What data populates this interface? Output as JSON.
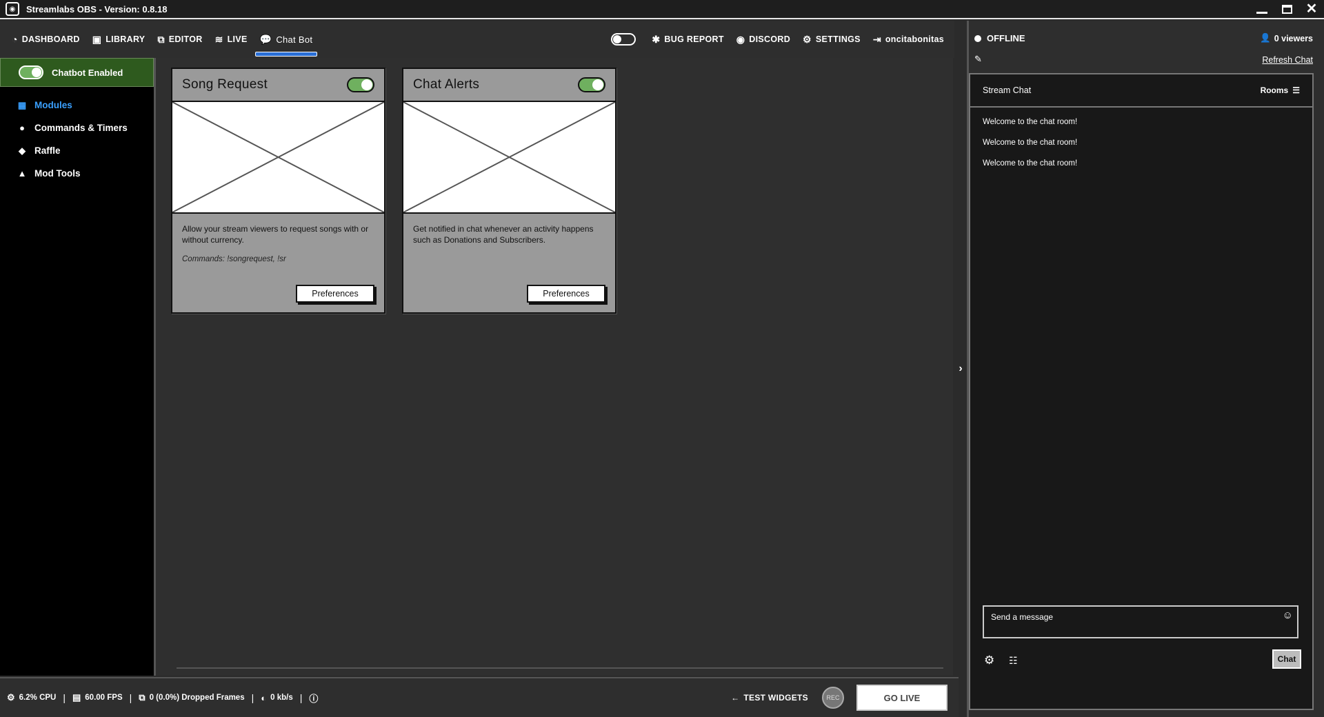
{
  "window": {
    "title": "Streamlabs OBS - Version: 0.8.18",
    "close_glyph": "✕"
  },
  "topnav": {
    "left": [
      {
        "label": "DASHBOARD",
        "icon": "dashboard-icon",
        "glyph": "◔"
      },
      {
        "label": "LIBRARY",
        "icon": "image-icon",
        "glyph": "▣"
      },
      {
        "label": "EDITOR",
        "icon": "editor-icon",
        "glyph": "⧉"
      },
      {
        "label": "LIVE",
        "icon": "rss-icon",
        "glyph": "≋"
      },
      {
        "label": "Chat Bot",
        "icon": "chat-bubble-icon",
        "glyph": "💬",
        "active": true
      }
    ],
    "right": [
      {
        "label": "BUG REPORT",
        "icon": "bug-icon",
        "glyph": "✱"
      },
      {
        "label": "DISCORD",
        "icon": "discord-icon",
        "glyph": "◉"
      },
      {
        "label": "SETTINGS",
        "icon": "gear-icon",
        "glyph": "⚙"
      },
      {
        "label": "oncitabonitas",
        "icon": "logout-icon",
        "glyph": "⇥"
      }
    ]
  },
  "sidebar": {
    "chatbot_enabled_label": "Chatbot Enabled",
    "chatbot_enabled": true,
    "items": [
      {
        "label": "Modules",
        "icon": "grid-icon",
        "glyph": "▦",
        "active": true
      },
      {
        "label": "Commands & Timers",
        "icon": "comment-icon",
        "glyph": "●"
      },
      {
        "label": "Raffle",
        "icon": "ticket-icon",
        "glyph": "◆"
      },
      {
        "label": "Mod Tools",
        "icon": "lock-icon",
        "glyph": "▲"
      }
    ]
  },
  "modules": [
    {
      "title": "Song Request",
      "enabled": true,
      "description": "Allow your stream viewers to request songs with or without currency.",
      "commands": "Commands: !songrequest, !sr",
      "button": "Preferences"
    },
    {
      "title": "Chat Alerts",
      "enabled": true,
      "description": "Get notified in chat whenever an activity happens such as Donations and Subscribers.",
      "commands": "",
      "button": "Preferences"
    }
  ],
  "chat_panel": {
    "status": "OFFLINE",
    "viewers": "0 viewers",
    "refresh_label": "Refresh Chat",
    "header": "Stream Chat",
    "rooms_label": "Rooms",
    "messages": [
      "Welcome to the chat room!",
      "Welcome to the chat room!",
      "Welcome to the chat room!"
    ],
    "input_placeholder": "Send a message",
    "send_label": "Chat"
  },
  "statusbar": {
    "cpu": "6.2% CPU",
    "fps": "60.00 FPS",
    "dropped": "0 (0.0%) Dropped Frames",
    "bandwidth": "0 kb/s",
    "test_widgets": "TEST WIDGETS",
    "rec": "REC",
    "go_live": "GO LIVE"
  },
  "colors": {
    "accent_blue": "#2a6fd6",
    "chatbot_green": "#2e5a1e",
    "toggle_green": "#6fb05f",
    "active_item": "#3aa0ff"
  }
}
